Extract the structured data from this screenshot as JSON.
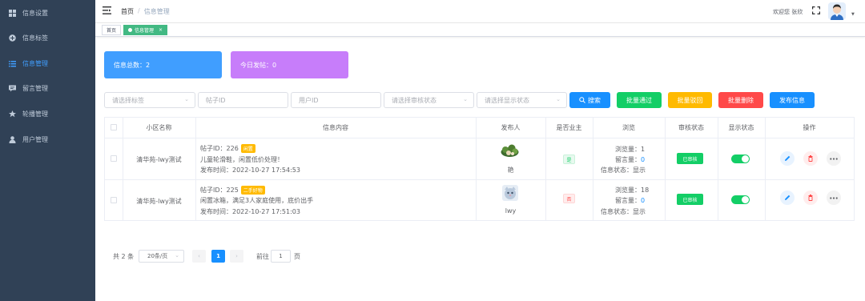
{
  "sidebar": {
    "items": [
      {
        "label": "信息设置",
        "icon": "grid-icon",
        "active": false
      },
      {
        "label": "信息标签",
        "icon": "circle-plus-icon",
        "active": false
      },
      {
        "label": "信息管理",
        "icon": "list-icon",
        "active": true
      },
      {
        "label": "留言管理",
        "icon": "message-icon",
        "active": false
      },
      {
        "label": "轮播管理",
        "icon": "star-icon",
        "active": false
      },
      {
        "label": "用户管理",
        "icon": "user-icon",
        "active": false
      }
    ]
  },
  "header": {
    "breadcrumb": [
      "首页",
      "信息管理"
    ],
    "welcome": "欢迎您 张欣"
  },
  "tags": [
    {
      "label": "首页",
      "active": false
    },
    {
      "label": "信息管理",
      "active": true,
      "close": "×"
    }
  ],
  "cards": [
    {
      "label": "信息总数：2",
      "color": "#409eff"
    },
    {
      "label": "今日发帖：0",
      "color": "#c77dfa"
    }
  ],
  "filters": {
    "tag_select": "请选择标签",
    "post_id": "帖子ID",
    "user_id": "用户ID",
    "audit_select": "请选择审核状态",
    "display_select": "请选择显示状态"
  },
  "buttons": {
    "search": "搜索",
    "batch_pass": "批量通过",
    "batch_reject": "批量驳回",
    "batch_delete": "批量删除",
    "publish": "发布信息"
  },
  "colors": {
    "primary": "#1890ff",
    "success": "#13ce66",
    "warning": "#ffba00",
    "danger": "#ff4949",
    "sidebar_bg": "#304156"
  },
  "table": {
    "headers": [
      "小区名称",
      "信息内容",
      "发布人",
      "是否业主",
      "浏览",
      "审核状态",
      "显示状态",
      "操作"
    ],
    "rows": [
      {
        "community": "清华苑-lwy测试",
        "post_id": "帖子ID：226",
        "tag": "闲置",
        "tag_color": "#ffba00",
        "content": "儿童轮滑鞋，闲置低价处理！",
        "time": "发布时间：2022-10-27 17:54:53",
        "publisher": "艳",
        "owner": "是",
        "owner_flag": true,
        "views_label": "浏览量：",
        "views": "1",
        "comments_label": "留言量：",
        "comments": "0",
        "display_label": "信息状态：显示",
        "audit": "已审核",
        "shown": true
      },
      {
        "community": "清华苑-lwy测试",
        "post_id": "帖子ID：225",
        "tag": "二手好物",
        "tag_color": "#ffba00",
        "content": "闲置冰箱，满足3人家庭使用，底价出手",
        "time": "发布时间：2022-10-27 17:51:03",
        "publisher": "lwy",
        "owner": "否",
        "owner_flag": false,
        "views_label": "浏览量：",
        "views": "18",
        "comments_label": "留言量：",
        "comments": "0",
        "display_label": "信息状态：显示",
        "audit": "已审核",
        "shown": true
      }
    ]
  },
  "pager": {
    "total": "共 2 条",
    "page_size": "20条/页",
    "current": "1",
    "goto": "前往",
    "goto_value": "1",
    "page_unit": "页",
    "prev": "‹",
    "next": "›"
  }
}
